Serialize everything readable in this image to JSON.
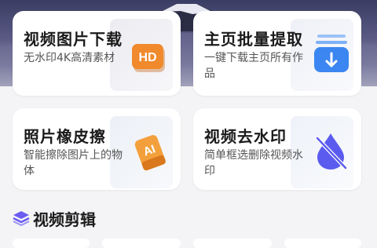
{
  "features": [
    {
      "title": "视频图片下载",
      "subtitle": "无水印4K高清素材",
      "icon": "hd-icon"
    },
    {
      "title": "主页批量提取",
      "subtitle": "一键下载主页所有作品",
      "icon": "download-stack-icon"
    },
    {
      "title": "照片橡皮擦",
      "subtitle": "智能擦除图片上的物体",
      "icon": "ai-eraser-icon"
    },
    {
      "title": "视频去水印",
      "subtitle": "简单框选删除视频水印",
      "icon": "water-drop-off-icon"
    }
  ],
  "section": {
    "title": "视频剪辑",
    "icon": "layers-icon"
  },
  "icons": {
    "hd_label": "HD",
    "ai_label": "AI"
  },
  "colors": {
    "orange": "#f08a2c",
    "blue": "#3b86f0",
    "purple": "#5b5bf0"
  }
}
